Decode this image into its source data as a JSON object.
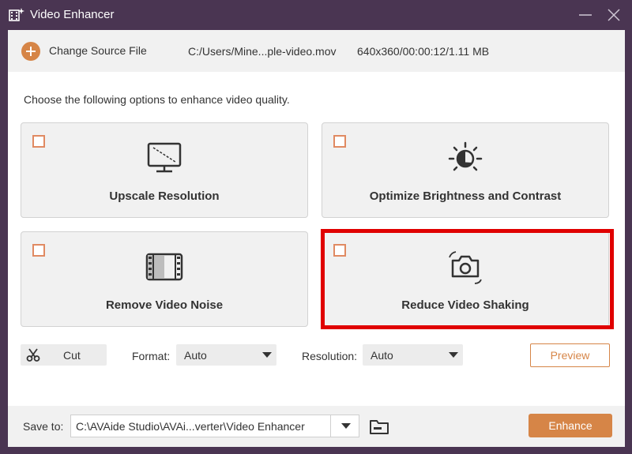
{
  "window": {
    "title": "Video Enhancer",
    "app_icon": "film-sparkle-icon",
    "minimize_icon": "minimize-icon",
    "close_icon": "close-icon"
  },
  "source": {
    "change_label": "Change Source File",
    "file_path": "C:/Users/Mine...ple-video.mov",
    "file_info": "640x360/00:00:12/1.11 MB"
  },
  "instruction": "Choose the following options to enhance video quality.",
  "options": [
    {
      "label": "Upscale Resolution",
      "icon": "monitor-upscale-icon",
      "checked": false
    },
    {
      "label": "Optimize Brightness and Contrast",
      "icon": "brightness-icon",
      "checked": false
    },
    {
      "label": "Remove Video Noise",
      "icon": "film-noise-icon",
      "checked": false
    },
    {
      "label": "Reduce Video Shaking",
      "icon": "camera-stabilize-icon",
      "checked": false
    }
  ],
  "controls": {
    "cut_label": "Cut",
    "format_label": "Format:",
    "format_value": "Auto",
    "resolution_label": "Resolution:",
    "resolution_value": "Auto",
    "preview_label": "Preview"
  },
  "footer": {
    "save_label": "Save to:",
    "save_path": "C:\\AVAide Studio\\AVAi...verter\\Video Enhancer",
    "enhance_label": "Enhance"
  },
  "colors": {
    "accent": "#d68547",
    "titlebar": "#4a3552",
    "highlight": "#e00000",
    "checkbox_border": "#e08a62"
  }
}
